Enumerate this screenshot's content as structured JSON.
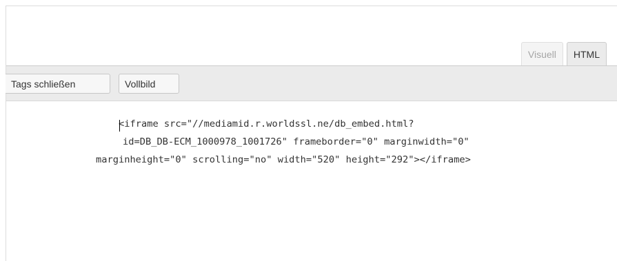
{
  "tabs": {
    "visual_label": "Visuell",
    "html_label": "HTML"
  },
  "toolbar": {
    "close_tags_label": "Tags schließen",
    "fullscreen_label": "Vollbild"
  },
  "editor": {
    "lines": [
      "<iframe src=\"//mediamid.r.worldssl.ne/db_embed.html?",
      "id=DB_DB-ECM_1000978_1001726\" frameborder=\"0\" marginwidth=\"0\"",
      "marginheight=\"0\" scrolling=\"no\" width=\"520\" height=\"292\"></iframe>"
    ]
  }
}
